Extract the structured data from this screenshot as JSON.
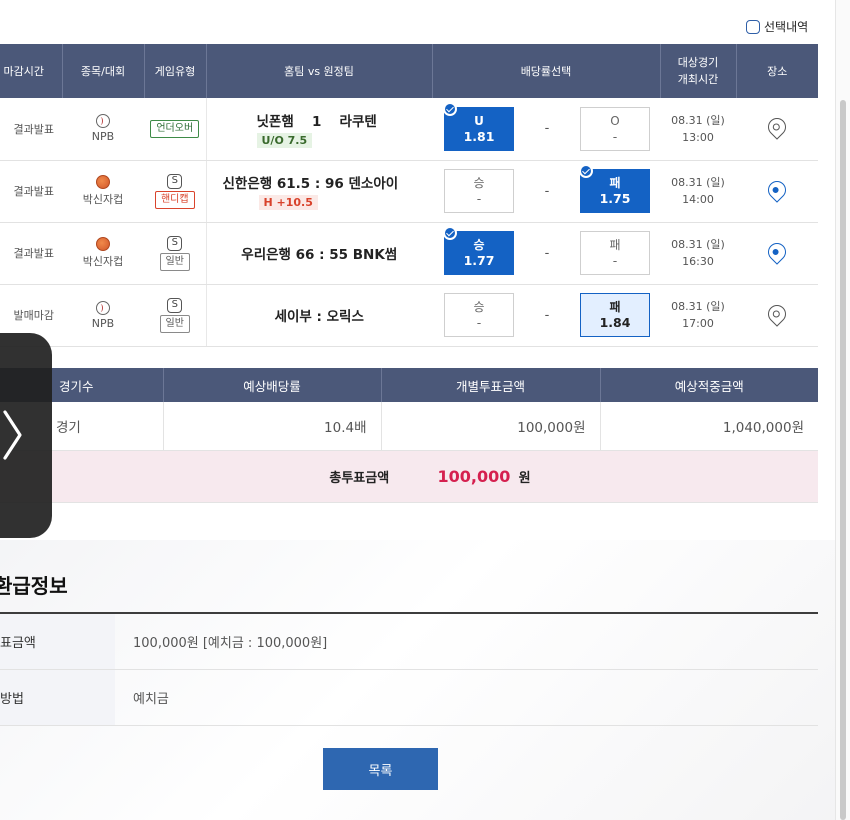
{
  "select_list": {
    "label": "선택내역"
  },
  "games_table": {
    "headers": [
      "마감시간",
      "종목/대회",
      "게임유형",
      "홈팀 vs 원정팀",
      "배당률선택",
      "대상경기\n개최시간",
      "장소"
    ],
    "rows": [
      {
        "status": "결과발표",
        "league": "NPB",
        "sport_icon": "baseball-icon",
        "type_badge": "언더오버",
        "type_style": "uo",
        "teams": "닛폰햄 　1　 라쿠텐",
        "tag": "U/O 7.5",
        "tag_style": "uo",
        "odd_left": {
          "label": "U",
          "value": "1.81",
          "selected": true
        },
        "odd_mid": "-",
        "odd_right": {
          "label": "O",
          "value": "-",
          "selected": false
        },
        "date": "08.31 (일)",
        "time": "13:00",
        "place_icon": "map-pin-icon"
      },
      {
        "status": "결과발표",
        "league": "박신자컵",
        "sport_icon": "basketball-icon",
        "type_s": "S",
        "type_badge": "핸디캡",
        "type_style": "hc",
        "teams": "신한은행 61.5 : 96 덴소아이",
        "tag": "H +10.5",
        "tag_style": "hc",
        "odd_left": {
          "label": "승",
          "value": "-",
          "selected": false
        },
        "odd_mid": "-",
        "odd_right": {
          "label": "패",
          "value": "1.75",
          "selected": true
        },
        "date": "08.31 (일)",
        "time": "14:00",
        "place_icon": "map-pin-star-icon"
      },
      {
        "status": "결과발표",
        "league": "박신자컵",
        "sport_icon": "basketball-icon",
        "type_s": "S",
        "type_badge": "일반",
        "type_style": "gen",
        "teams": "우리은행 66 : 55 BNK썸",
        "tag": "",
        "odd_left": {
          "label": "승",
          "value": "1.77",
          "selected": true
        },
        "odd_mid": "-",
        "odd_right": {
          "label": "패",
          "value": "-",
          "selected": false
        },
        "date": "08.31 (일)",
        "time": "16:30",
        "place_icon": "map-pin-star-icon"
      },
      {
        "status": "발매마감",
        "league": "NPB",
        "sport_icon": "baseball-icon",
        "type_s": "S",
        "type_badge": "일반",
        "type_style": "gen",
        "teams": "세이부 : 오릭스",
        "tag": "",
        "odd_left": {
          "label": "승",
          "value": "-",
          "selected": false
        },
        "odd_mid": "-",
        "odd_right": {
          "label": "패",
          "value": "1.84",
          "selected": "light"
        },
        "date": "08.31 (일)",
        "time": "17:00",
        "place_icon": "map-pin-icon"
      }
    ]
  },
  "summary": {
    "headers": [
      "경기수",
      "예상배당률",
      "개별투표금액",
      "예상적중금액"
    ],
    "row": [
      "경기",
      "10.4배",
      "100,000원",
      "1,040,000원"
    ],
    "total_label": "총투표금액",
    "total_amount": "100,000",
    "total_unit": "원"
  },
  "refund": {
    "title": "환급정보",
    "rows": [
      {
        "label": "표금액",
        "value": "100,000원 [예치금 : 100,000원]"
      },
      {
        "label": "방법",
        "value": "예치금"
      }
    ]
  },
  "list_button": "목록",
  "colors": {
    "header": "#4b5879",
    "accent": "#1462c4",
    "total": "#d5204f",
    "button": "#2e67b1"
  }
}
